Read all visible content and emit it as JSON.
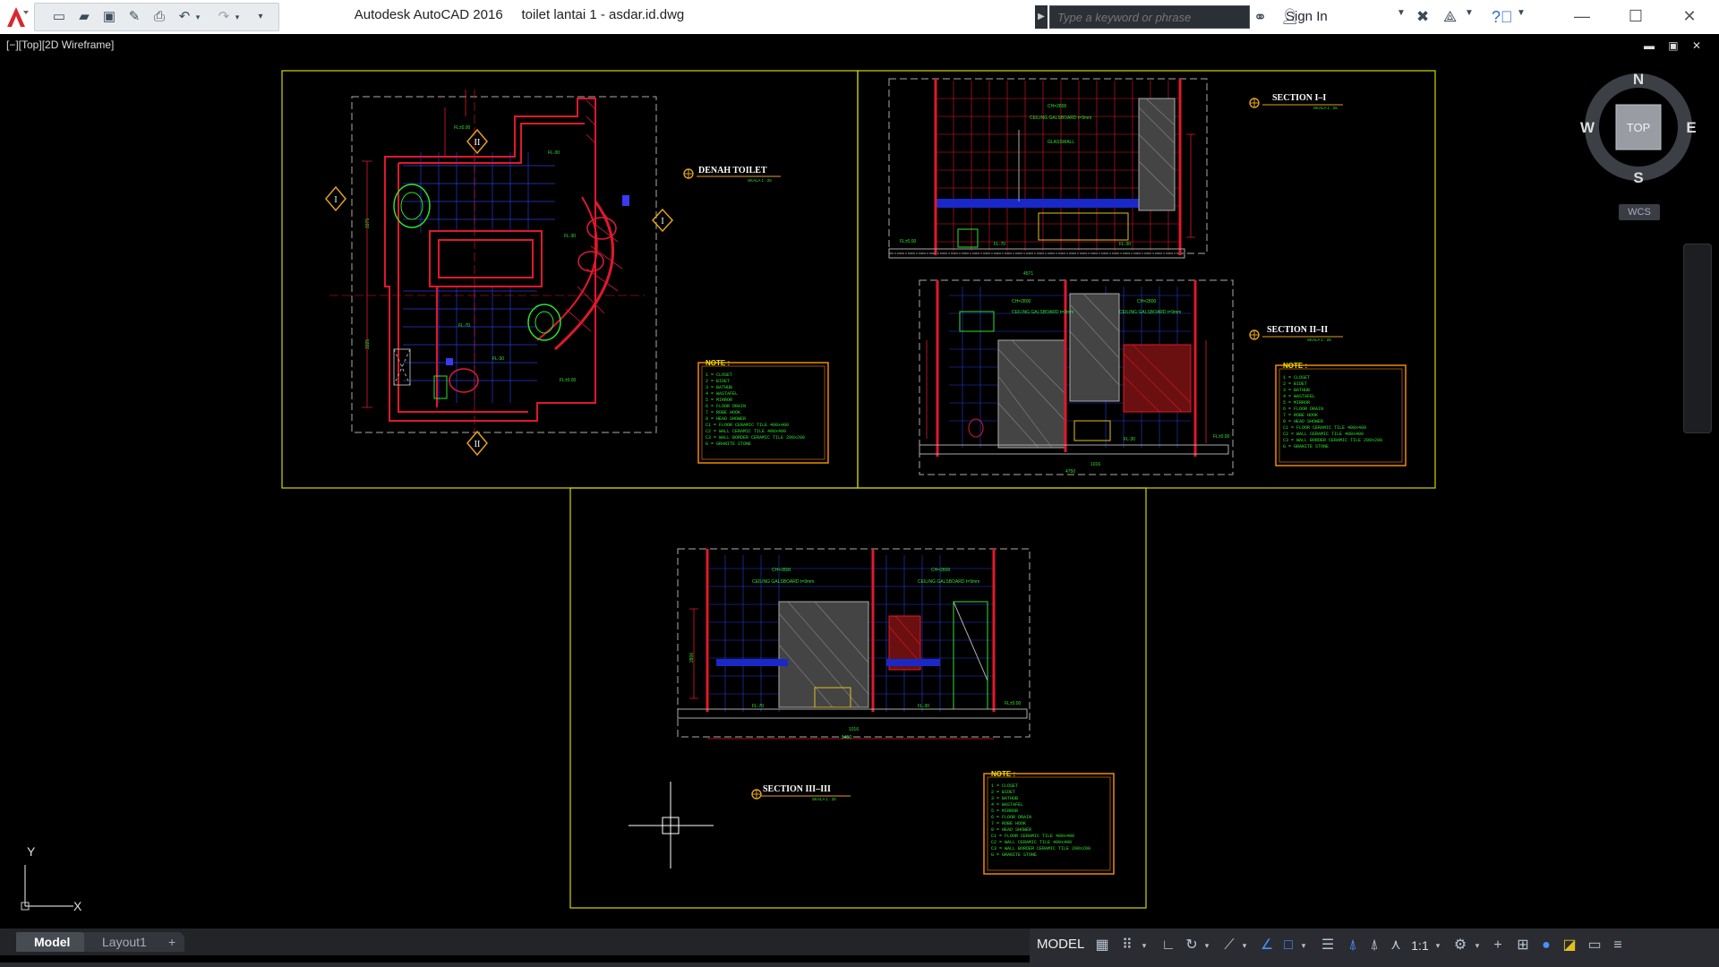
{
  "window": {
    "title": "Autodesk AutoCAD 2016     toilet lantai 1 - asdar.id.dwg",
    "search_placeholder": "Type a keyword or phrase",
    "sign_in": "Sign In"
  },
  "viewport": {
    "label": "[−][Top][2D Wireframe]",
    "controls": "▬ ▣ ✕"
  },
  "viewcube": {
    "n": "N",
    "s": "S",
    "e": "E",
    "w": "W",
    "face": "TOP",
    "wcs": "WCS"
  },
  "ucs": {
    "x": "X",
    "y": "Y"
  },
  "drawings": {
    "plan_title": "DENAH TOILET",
    "plan_scale": "SKALA 1 : 25",
    "sec1_title": "SECTION I–I",
    "sec1_scale": "SKALA 1 : 25",
    "sec2_title": "SECTION II–II",
    "sec2_scale": "SKALA 1 : 25",
    "sec3_title": "SECTION III–III",
    "sec3_scale": "SKALA 1 : 25",
    "bubble_1": "I",
    "bubble_2": "II",
    "note_heading": "NOTE :",
    "notes": [
      "1  = CLOSET",
      "2  = BIDET",
      "3  = BATHUB",
      "4  = WASTAFEL",
      "5  = MIRROR",
      "6  = FLOOR DRAIN",
      "7  = ROBE HOOK",
      "8  = HEAD SHOWER",
      "C1 = FLOOR CERAMIC TILE 400x400",
      "C2 = WALL CERAMIC TILE 400x400",
      "C3 = WALL BORDER CERAMIC TILE 200x200",
      "G  = GRANITE STONE"
    ],
    "labels": {
      "ch": "CH=2800",
      "ceiling": "CEILING GALSBOARD t=9mm",
      "glasswall": "GLASSWALL",
      "fl000": "FL±0.00",
      "fl30": "FL-30",
      "fl70": "FL-70",
      "dim_4571": "4571",
      "dim_4750": "4750",
      "dim_1016": "1016",
      "dim_5450": "5450",
      "dim_2800": "2800",
      "dim_3375": "3375",
      "dim_3325": "3325"
    }
  },
  "tabs": {
    "model": "Model",
    "layout1": "Layout1",
    "add": "+"
  },
  "status": {
    "model": "MODEL",
    "scale": "1:1"
  }
}
